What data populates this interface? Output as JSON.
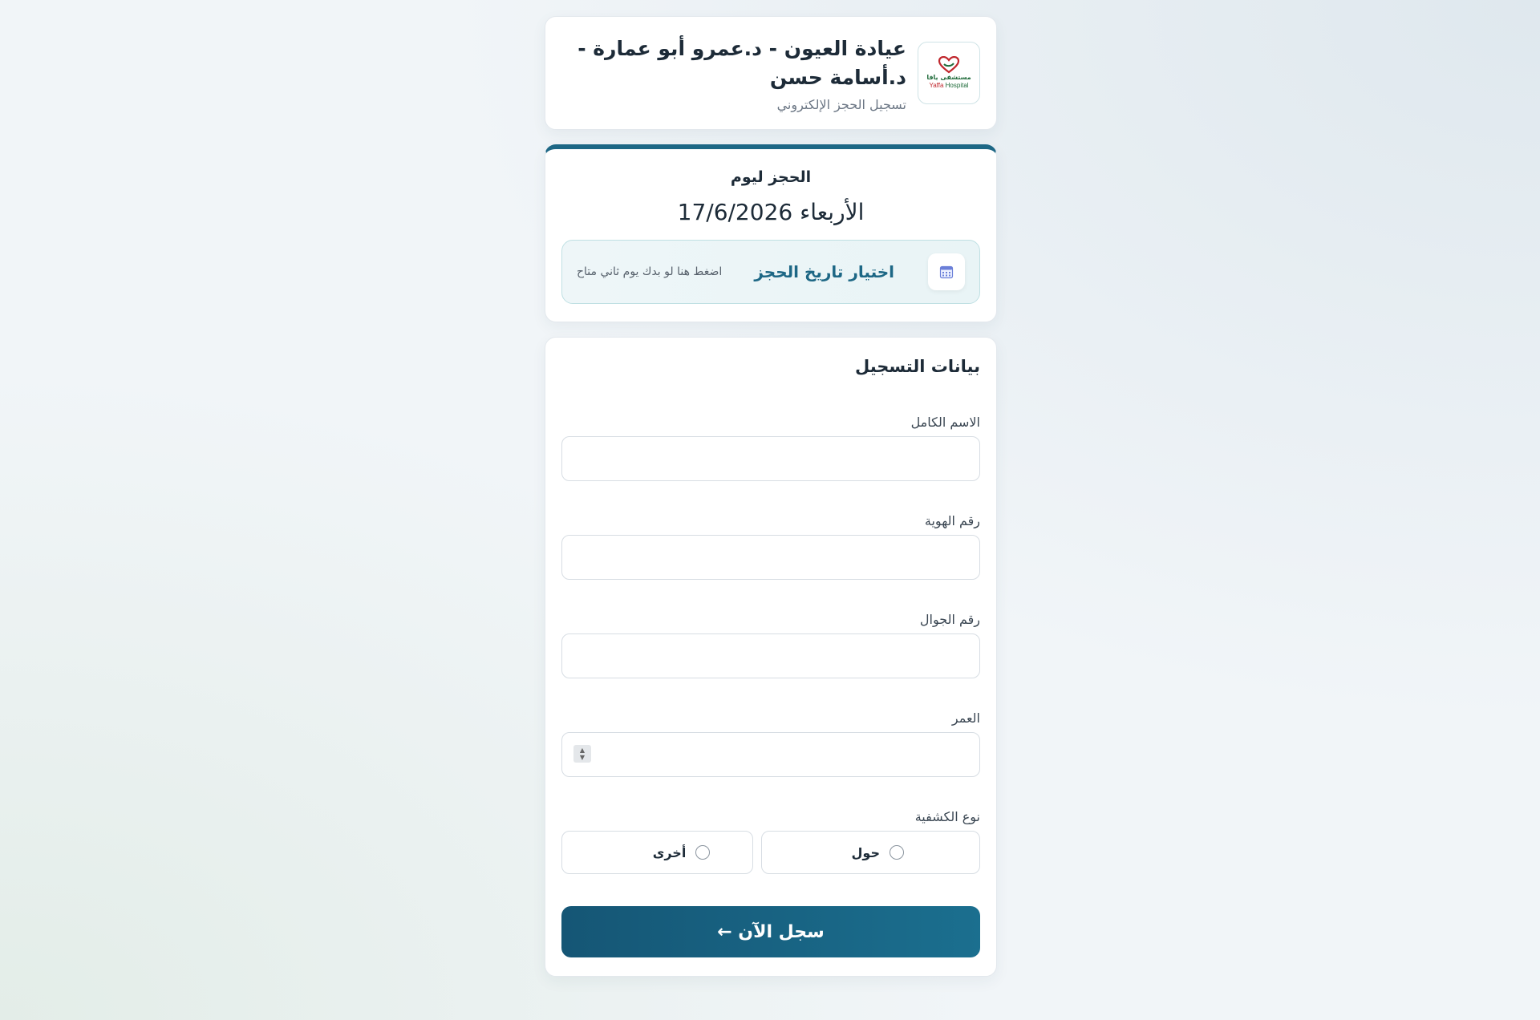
{
  "header": {
    "logo_ar": "مستشفى يافا",
    "logo_en_brand": "Yaffa",
    "logo_en_word": "Hospital",
    "title": "عيادة العيون - د.عمرو أبو عمارة - د.أسامة حسن",
    "subtitle": "تسجيل الحجز الإلكتروني"
  },
  "booking": {
    "label": "الحجز ليوم",
    "date": "الأربعاء 17/6/2026",
    "picker_title": "اختيار تاريخ الحجز",
    "picker_hint": "اضغط هنا لو بدك يوم ثاني متاح",
    "picker_icon": "calendar-icon"
  },
  "form": {
    "title": "بيانات التسجيل",
    "fields": {
      "full_name": {
        "label": "الاسم الكامل",
        "value": ""
      },
      "id_number": {
        "label": "رقم الهوية",
        "value": ""
      },
      "mobile": {
        "label": "رقم الجوال",
        "value": ""
      },
      "age": {
        "label": "العمر",
        "value": ""
      }
    },
    "exam_type": {
      "label": "نوع الكشفية",
      "options": [
        "حول",
        "أخرى"
      ],
      "selected": null
    },
    "submit_label": "سجل الآن ←"
  },
  "colors": {
    "accent": "#1d6785",
    "button_start": "#155675",
    "button_end": "#1b6f8f",
    "logo_red": "#c0272d",
    "logo_green": "#1f6b3a"
  }
}
